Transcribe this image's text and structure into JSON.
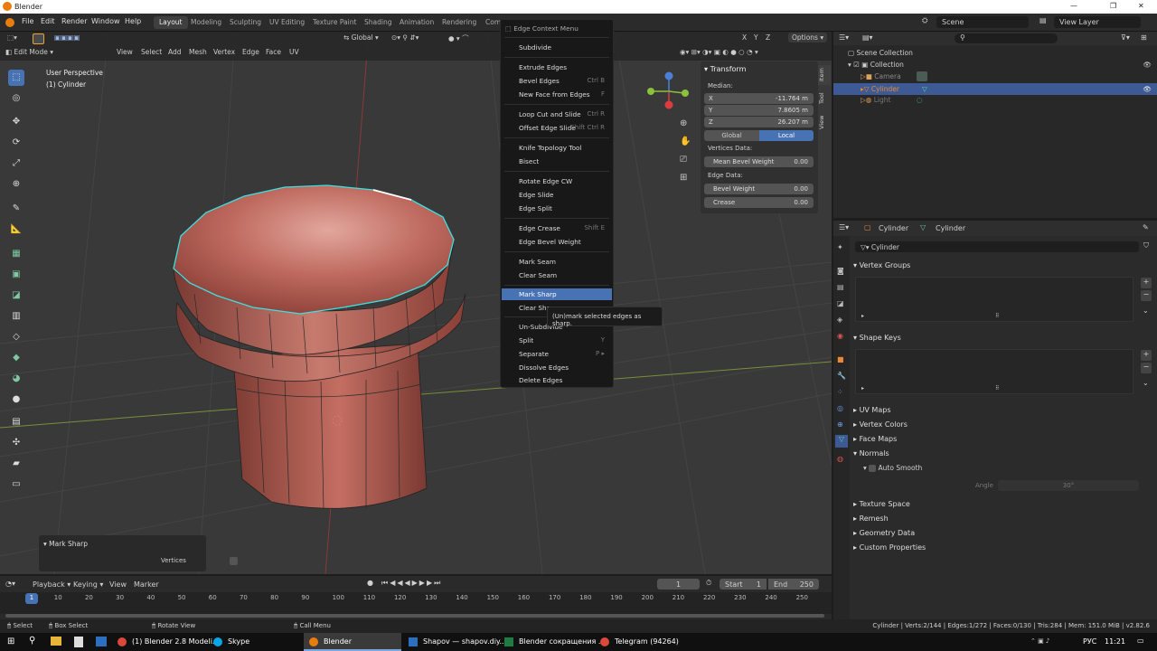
{
  "window": {
    "title": "Blender",
    "controls": [
      "—",
      "❐",
      "✕"
    ]
  },
  "menus": [
    "File",
    "Edit",
    "Render",
    "Window",
    "Help"
  ],
  "workspaces": [
    "Layout",
    "Modeling",
    "Sculpting",
    "UV Editing",
    "Texture Paint",
    "Shading",
    "Animation",
    "Rendering",
    "Com"
  ],
  "scene": {
    "name": "Scene",
    "view_layer": "View Layer"
  },
  "viewport": {
    "mode": "Edit Mode",
    "header_menus": [
      "View",
      "Select",
      "Add",
      "Mesh",
      "Vertex",
      "Edge",
      "Face",
      "UV"
    ],
    "orientation": "Global",
    "options_label": "Options",
    "overlay_text": [
      "User Perspective",
      "(1) Cylinder"
    ],
    "axes": [
      "X",
      "Y",
      "Z"
    ],
    "operator_panel": {
      "title": "Mark Sharp",
      "option": "Vertices"
    }
  },
  "n_panel": {
    "tabs": [
      "Item",
      "Tool",
      "View"
    ],
    "title": "Transform",
    "median_label": "Median:",
    "coords": [
      {
        "axis": "X",
        "value": "-11.764 m"
      },
      {
        "axis": "Y",
        "value": "7.8605 m"
      },
      {
        "axis": "Z",
        "value": "26.207 m"
      }
    ],
    "space_buttons": [
      "Global",
      "Local"
    ],
    "vertices_data_label": "Vertices Data:",
    "mean_bevel": {
      "label": "Mean Bevel Weight",
      "value": "0.00"
    },
    "edge_data_label": "Edge Data:",
    "bevel_weight": {
      "label": "Bevel Weight",
      "value": "0.00"
    },
    "crease": {
      "label": "Crease",
      "value": "0.00"
    }
  },
  "context_menu": {
    "title": "Edge Context Menu",
    "items": [
      {
        "label": "Subdivide",
        "shortcut": ""
      },
      {
        "label": "Extrude Edges",
        "shortcut": ""
      },
      {
        "label": "Bevel Edges",
        "shortcut": "Ctrl B"
      },
      {
        "label": "New Face from Edges",
        "shortcut": "F"
      },
      {
        "label": "Loop Cut and Slide",
        "shortcut": "Ctrl R"
      },
      {
        "label": "Offset Edge Slide",
        "shortcut": "Shift Ctrl R"
      },
      {
        "label": "Knife Topology Tool",
        "shortcut": ""
      },
      {
        "label": "Bisect",
        "shortcut": ""
      },
      {
        "label": "Rotate Edge CW",
        "shortcut": ""
      },
      {
        "label": "Edge Slide",
        "shortcut": ""
      },
      {
        "label": "Edge Split",
        "shortcut": ""
      },
      {
        "label": "Edge Crease",
        "shortcut": "Shift E"
      },
      {
        "label": "Edge Bevel Weight",
        "shortcut": ""
      },
      {
        "label": "Mark Seam",
        "shortcut": ""
      },
      {
        "label": "Clear Seam",
        "shortcut": ""
      },
      {
        "label": "Mark Sharp",
        "shortcut": ""
      },
      {
        "label": "Clear Sharp",
        "shortcut": ""
      },
      {
        "label": "Un-Subdivide",
        "shortcut": ""
      },
      {
        "label": "Split",
        "shortcut": "Y"
      },
      {
        "label": "Separate",
        "shortcut": "P ▸"
      },
      {
        "label": "Dissolve Edges",
        "shortcut": ""
      },
      {
        "label": "Delete Edges",
        "shortcut": ""
      }
    ],
    "highlighted": "Mark Sharp",
    "tooltip": "(Un)mark selected edges as sharp."
  },
  "outliner": {
    "root": "Scene Collection",
    "collection": "Collection",
    "objects": [
      {
        "name": "Camera",
        "selected": false
      },
      {
        "name": "Cylinder",
        "selected": true
      },
      {
        "name": "Light",
        "selected": false
      }
    ]
  },
  "properties": {
    "object": "Cylinder",
    "data": "Cylinder",
    "data_name": "Cylinder",
    "sections": [
      "Vertex Groups",
      "Shape Keys",
      "UV Maps",
      "Vertex Colors",
      "Face Maps",
      "Normals",
      "Texture Space",
      "Remesh",
      "Geometry Data",
      "Custom Properties"
    ],
    "auto_smooth": "Auto Smooth",
    "angle_label": "Angle",
    "angle_value": "30°"
  },
  "timeline": {
    "menus": [
      "Playback",
      "Keying",
      "View",
      "Marker"
    ],
    "current_frame": "1",
    "start_label": "Start",
    "start": "1",
    "end_label": "End",
    "end": "250",
    "ticks": [
      "1",
      "10",
      "20",
      "30",
      "40",
      "50",
      "60",
      "70",
      "80",
      "90",
      "100",
      "110",
      "120",
      "130",
      "140",
      "150",
      "160",
      "170",
      "180",
      "190",
      "200",
      "210",
      "220",
      "230",
      "240",
      "250"
    ]
  },
  "statusbar": {
    "hints": [
      "Select",
      "Box Select",
      "Rotate View",
      "Call Menu"
    ],
    "stats": "Cylinder | Verts:2/144 | Edges:1/272 | Faces:0/130 | Tris:284 | Mem: 151.0 MiB | v2.82.6"
  },
  "taskbar": {
    "apps": [
      "(1) Blender 2.8 Modeli...",
      "Skype",
      "Blender",
      "Shapov — shapov.diy...",
      "Blender сокращения ...",
      "Telegram (94264)"
    ],
    "lang": "РУС",
    "time": "11:21"
  },
  "colors": {
    "accent": "#4772b3",
    "selected_edge": "#3ee0e0",
    "mesh": "#b85f56",
    "grid": "#393939"
  }
}
